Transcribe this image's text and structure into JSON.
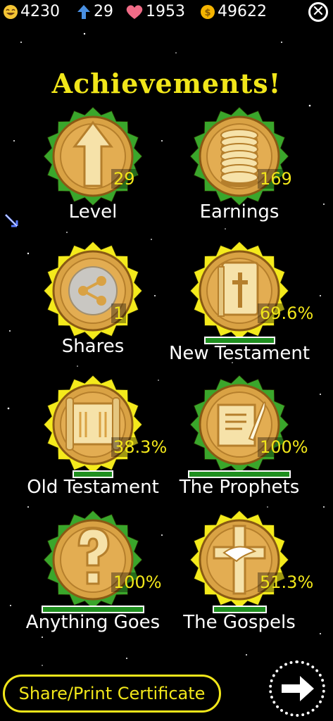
{
  "stats": {
    "emoji_count": "4230",
    "level": "29",
    "hearts": "1953",
    "coins": "49622"
  },
  "title": "Achievements!",
  "badges": [
    {
      "label": "Level",
      "value": "29",
      "icon": "up-arrow-icon",
      "rim": "green-star"
    },
    {
      "label": "Earnings",
      "value": "169",
      "icon": "coin-stack-icon",
      "rim": "green-star"
    },
    {
      "label": "Shares",
      "value": "1",
      "icon": "share-icon",
      "rim": "yellow-star"
    },
    {
      "label": "New Testament",
      "value": "69.6%",
      "progress": 0.696,
      "icon": "bible-icon",
      "rim": "yellow-star"
    },
    {
      "label": "Old Testament",
      "value": "38.3%",
      "progress": 0.383,
      "icon": "scroll-icon",
      "rim": "yellow-star"
    },
    {
      "label": "The Prophets",
      "value": "100%",
      "progress": 1.0,
      "icon": "quill-parchment-icon",
      "rim": "green-star"
    },
    {
      "label": "Anything Goes",
      "value": "100%",
      "progress": 1.0,
      "icon": "question-mark-icon",
      "rim": "green-star"
    },
    {
      "label": "The Gospels",
      "value": "51.3%",
      "progress": 0.513,
      "icon": "cross-dove-icon",
      "rim": "yellow-star"
    }
  ],
  "share_button": "Share/Print Certificate",
  "colors": {
    "title": "#f1e61a",
    "green_rim": "#3aa62b",
    "yellow_rim": "#f4ea1c",
    "coin": "#d9a244",
    "progress": "#1f8f1f"
  }
}
